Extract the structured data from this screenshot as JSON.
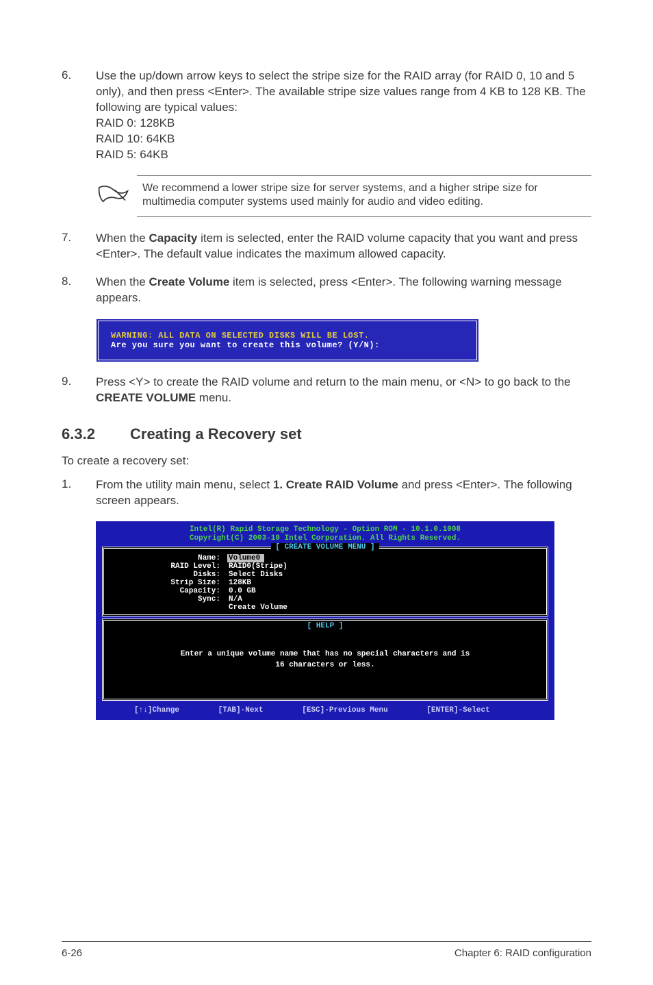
{
  "steps": {
    "s6": {
      "num": "6.",
      "body": "Use the up/down arrow keys to select the stripe size for the RAID array (for RAID 0, 10 and 5 only), and then press <Enter>. The available stripe size values range from 4 KB to 128 KB. The following are typical values:",
      "sub1": "RAID 0: 128KB",
      "sub2": "RAID 10: 64KB",
      "sub3": "RAID 5: 64KB"
    },
    "note": "We recommend a lower stripe size for server systems, and a higher stripe size for multimedia computer systems used mainly for audio and video editing.",
    "s7": {
      "num": "7.",
      "prefix": "When the ",
      "bold": "Capacity",
      "suffix": " item is selected, enter the RAID volume capacity that you want and press <Enter>. The default value indicates the maximum allowed capacity."
    },
    "s8": {
      "num": "8.",
      "prefix": "When the ",
      "bold": "Create Volume",
      "suffix": " item is selected, press <Enter>. The following warning message appears."
    },
    "warn": {
      "line1": "WARNING: ALL DATA ON SELECTED DISKS WILL BE LOST.",
      "line2": "Are you sure you want to create this volume? (Y/N):"
    },
    "s9": {
      "num": "9.",
      "prefix": "Press <Y> to create the RAID volume and return to the main menu, or <N> to go back to the ",
      "bold": "CREATE VOLUME",
      "suffix": " menu."
    }
  },
  "section": {
    "num": "6.3.2",
    "title": "Creating a Recovery set"
  },
  "intro": "To create a recovery set:",
  "step1": {
    "num": "1.",
    "prefix": "From the utility main menu, select ",
    "bold": "1. Create RAID Volume",
    "suffix": " and press <Enter>. The following screen appears."
  },
  "bios": {
    "title1": "Intel(R) Rapid Storage Technology - Option ROM - 10.1.0.1008",
    "title2": "Copyright(C) 2003-10 Intel Corporation.  All Rights Reserved.",
    "box_title": "[ CREATE VOLUME MENU ]",
    "rows": {
      "name_k": "Name:",
      "name_v": "Volume0",
      "raid_k": "RAID Level:",
      "raid_v": "RAID0(Stripe)",
      "disks_k": "Disks:",
      "disks_v": "Select Disks",
      "strip_k": "Strip Size:",
      "strip_v": "128KB",
      "cap_k": "Capacity:",
      "cap_v": "0.0   GB",
      "sync_k": "Sync:",
      "sync_v": "N/A",
      "create": "Create Volume"
    },
    "help_title": "[ HELP ]",
    "help_text1": "Enter a unique volume name that has no special characters and is",
    "help_text2": "16 characters or less.",
    "footer": {
      "f1": "[↑↓]Change",
      "f2": "[TAB]-Next",
      "f3": "[ESC]-Previous Menu",
      "f4": "[ENTER]-Select"
    }
  },
  "footer": {
    "left": "6-26",
    "right": "Chapter 6: RAID configuration"
  }
}
